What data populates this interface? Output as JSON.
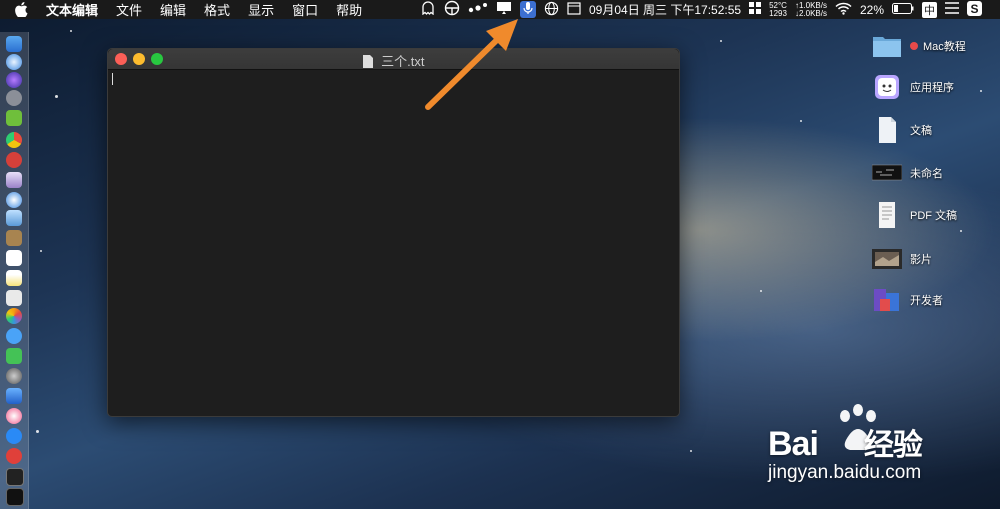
{
  "menubar": {
    "app_name": "文本编辑",
    "items": [
      "文件",
      "编辑",
      "格式",
      "显示",
      "窗口",
      "帮助"
    ],
    "clock": "09月04日 周三 下午17:52:55",
    "temp": "52°C",
    "fan": "1293",
    "net_up": "↑1.0KB/s",
    "net_down": "↓2.0KB/s",
    "battery": "22%",
    "input_method": "中"
  },
  "window": {
    "title": "三个.txt",
    "content": ""
  },
  "desktop": {
    "items": [
      {
        "label": "Mac教程",
        "icon": "folder-icon",
        "tag_color": "#e84a4a"
      },
      {
        "label": "应用程序",
        "icon": "applications-icon"
      },
      {
        "label": "文稿",
        "icon": "document-icon"
      },
      {
        "label": "未命名",
        "icon": "screenshot-icon"
      },
      {
        "label": "PDF 文稿",
        "icon": "pdf-icon"
      },
      {
        "label": "影片",
        "icon": "movie-icon"
      },
      {
        "label": "开发者",
        "icon": "developer-icon"
      }
    ]
  },
  "watermark": {
    "brand": "Bai",
    "brand2": "经验",
    "url": "jingyan.baidu.com"
  },
  "colors": {
    "menubar": "#1a1a1a",
    "window_bg": "#1e1e1e",
    "arrow": "#f08a2c",
    "close": "#fc5f57",
    "minimize": "#fdbc2e",
    "zoom": "#28c840"
  }
}
